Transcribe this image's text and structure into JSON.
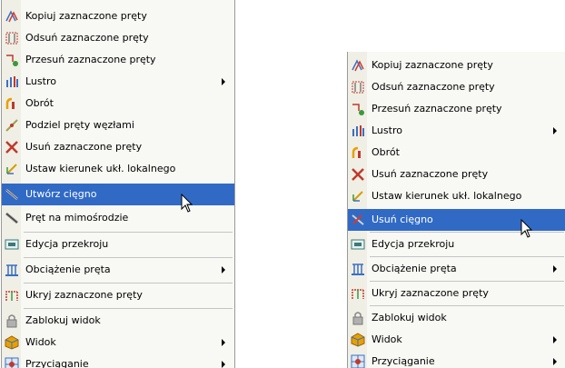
{
  "left_menu": {
    "items": [
      {
        "label": "Kopiuj zaznaczone pręty",
        "icon": "copy-bars-icon"
      },
      {
        "label": "Odsuń zaznaczone pręty",
        "icon": "offset-bars-icon"
      },
      {
        "label": "Przesuń zaznaczone pręty",
        "icon": "move-bars-icon"
      },
      {
        "label": "Lustro",
        "icon": "mirror-icon",
        "submenu": true
      },
      {
        "label": "Obrót",
        "icon": "rotate-icon"
      },
      {
        "label": "Podziel pręty węzłami",
        "icon": "divide-bars-icon"
      },
      {
        "label": "Usuń zaznaczone pręty",
        "icon": "delete-bars-icon"
      },
      {
        "label": "Ustaw kierunek ukł. lokalnego",
        "icon": "local-axis-icon"
      },
      {
        "label": "Utwórz cięgno",
        "icon": "create-cable-icon",
        "highlighted": true
      },
      {
        "label": "Pręt na mimośrodzie",
        "icon": "eccentric-bar-icon"
      },
      {
        "label": "Edycja przekroju",
        "icon": "section-edit-icon"
      },
      {
        "label": "Obciążenie pręta",
        "icon": "bar-load-icon",
        "submenu": true
      },
      {
        "label": "Ukryj zaznaczone pręty",
        "icon": "hide-bars-icon"
      },
      {
        "label": "Zablokuj widok",
        "icon": "lock-view-icon"
      },
      {
        "label": "Widok",
        "icon": "view-icon",
        "submenu": true
      },
      {
        "label": "Przyciąganie",
        "icon": "snap-icon",
        "submenu": true
      }
    ]
  },
  "right_menu": {
    "items": [
      {
        "label": "Kopiuj zaznaczone pręty",
        "icon": "copy-bars-icon"
      },
      {
        "label": "Odsuń zaznaczone pręty",
        "icon": "offset-bars-icon"
      },
      {
        "label": "Przesuń zaznaczone pręty",
        "icon": "move-bars-icon"
      },
      {
        "label": "Lustro",
        "icon": "mirror-icon",
        "submenu": true
      },
      {
        "label": "Obrót",
        "icon": "rotate-icon"
      },
      {
        "label": "Usuń zaznaczone pręty",
        "icon": "delete-bars-icon"
      },
      {
        "label": "Ustaw kierunek ukł. lokalnego",
        "icon": "local-axis-icon"
      },
      {
        "label": "Usuń cięgno",
        "icon": "delete-cable-icon",
        "highlighted": true
      },
      {
        "label": "Edycja przekroju",
        "icon": "section-edit-icon"
      },
      {
        "label": "Obciążenie pręta",
        "icon": "bar-load-icon",
        "submenu": true
      },
      {
        "label": "Ukryj zaznaczone pręty",
        "icon": "hide-bars-icon"
      },
      {
        "label": "Zablokuj widok",
        "icon": "lock-view-icon"
      },
      {
        "label": "Widok",
        "icon": "view-icon",
        "submenu": true
      },
      {
        "label": "Przyciąganie",
        "icon": "snap-icon",
        "submenu": true
      }
    ]
  },
  "colors": {
    "highlight": "#316ac5",
    "menu_bg": "#f8f8f4",
    "gutter_bg": "#f0efe6"
  }
}
